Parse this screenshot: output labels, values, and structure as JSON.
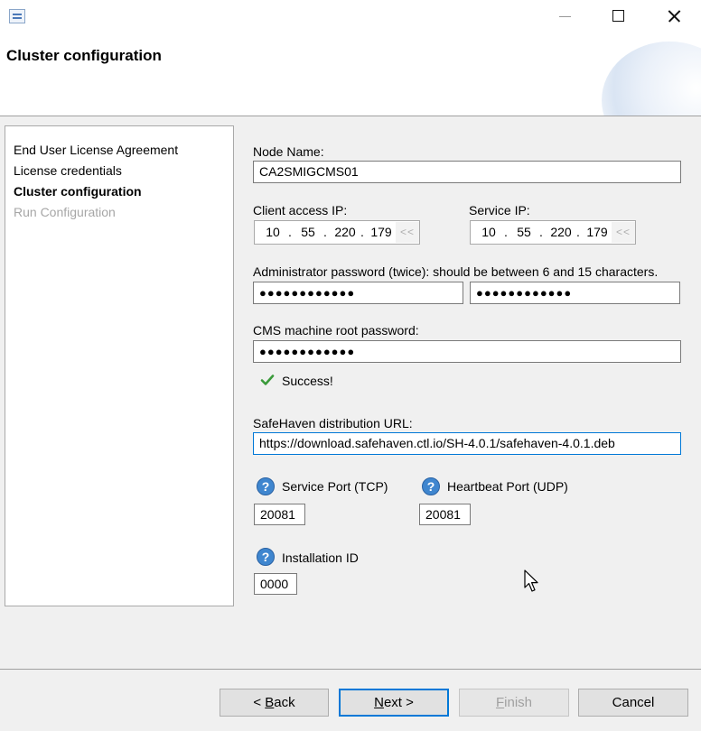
{
  "window": {
    "title": ""
  },
  "header": {
    "title": "Cluster configuration"
  },
  "steps": [
    {
      "label": "End User License Agreement",
      "state": "done"
    },
    {
      "label": "License credentials",
      "state": "done"
    },
    {
      "label": "Cluster configuration",
      "state": "current"
    },
    {
      "label": "Run Configuration",
      "state": "todo"
    }
  ],
  "form": {
    "node_name_label": "Node Name:",
    "node_name_value": "CA2SMIGCMS01",
    "client_ip_label": "Client access IP:",
    "client_ip": [
      "10",
      "55",
      "220",
      "179"
    ],
    "service_ip_label": "Service IP:",
    "service_ip": [
      "10",
      "55",
      "220",
      "179"
    ],
    "ip_button_label": "<<",
    "ip_dot": ".",
    "admin_pwd_label": "Administrator password (twice): should be between 6 and 15 characters.",
    "admin_pwd_1": "●●●●●●●●●●●●",
    "admin_pwd_2": "●●●●●●●●●●●●",
    "cms_pwd_label": "CMS machine root password:",
    "cms_pwd": "●●●●●●●●●●●●",
    "status_text": "Success!",
    "url_label": "SafeHaven distribution URL:",
    "url_value": "https://download.safehaven.ctl.io/SH-4.0.1/safehaven-4.0.1.deb",
    "service_port_label": "Service Port (TCP)",
    "service_port_value": "20081",
    "heartbeat_port_label": "Heartbeat Port (UDP)",
    "heartbeat_port_value": "20081",
    "installation_id_label": "Installation ID",
    "installation_id_value": "0000",
    "help_glyph": "?"
  },
  "buttons": {
    "back_pre": "< ",
    "back_key": "B",
    "back_post": "ack",
    "next_key": "N",
    "next_post": "ext >",
    "finish_key": "F",
    "finish_post": "inish",
    "cancel": "Cancel"
  },
  "icons": {
    "app": "app-icon",
    "check": "check-icon",
    "help": "help-icon",
    "cursor": "mouse-cursor-icon"
  },
  "colors": {
    "accent": "#0078d7",
    "help_icon": "#3f86cf",
    "success_check": "#3a9a3a",
    "disabled_text": "#a6a6a6"
  }
}
